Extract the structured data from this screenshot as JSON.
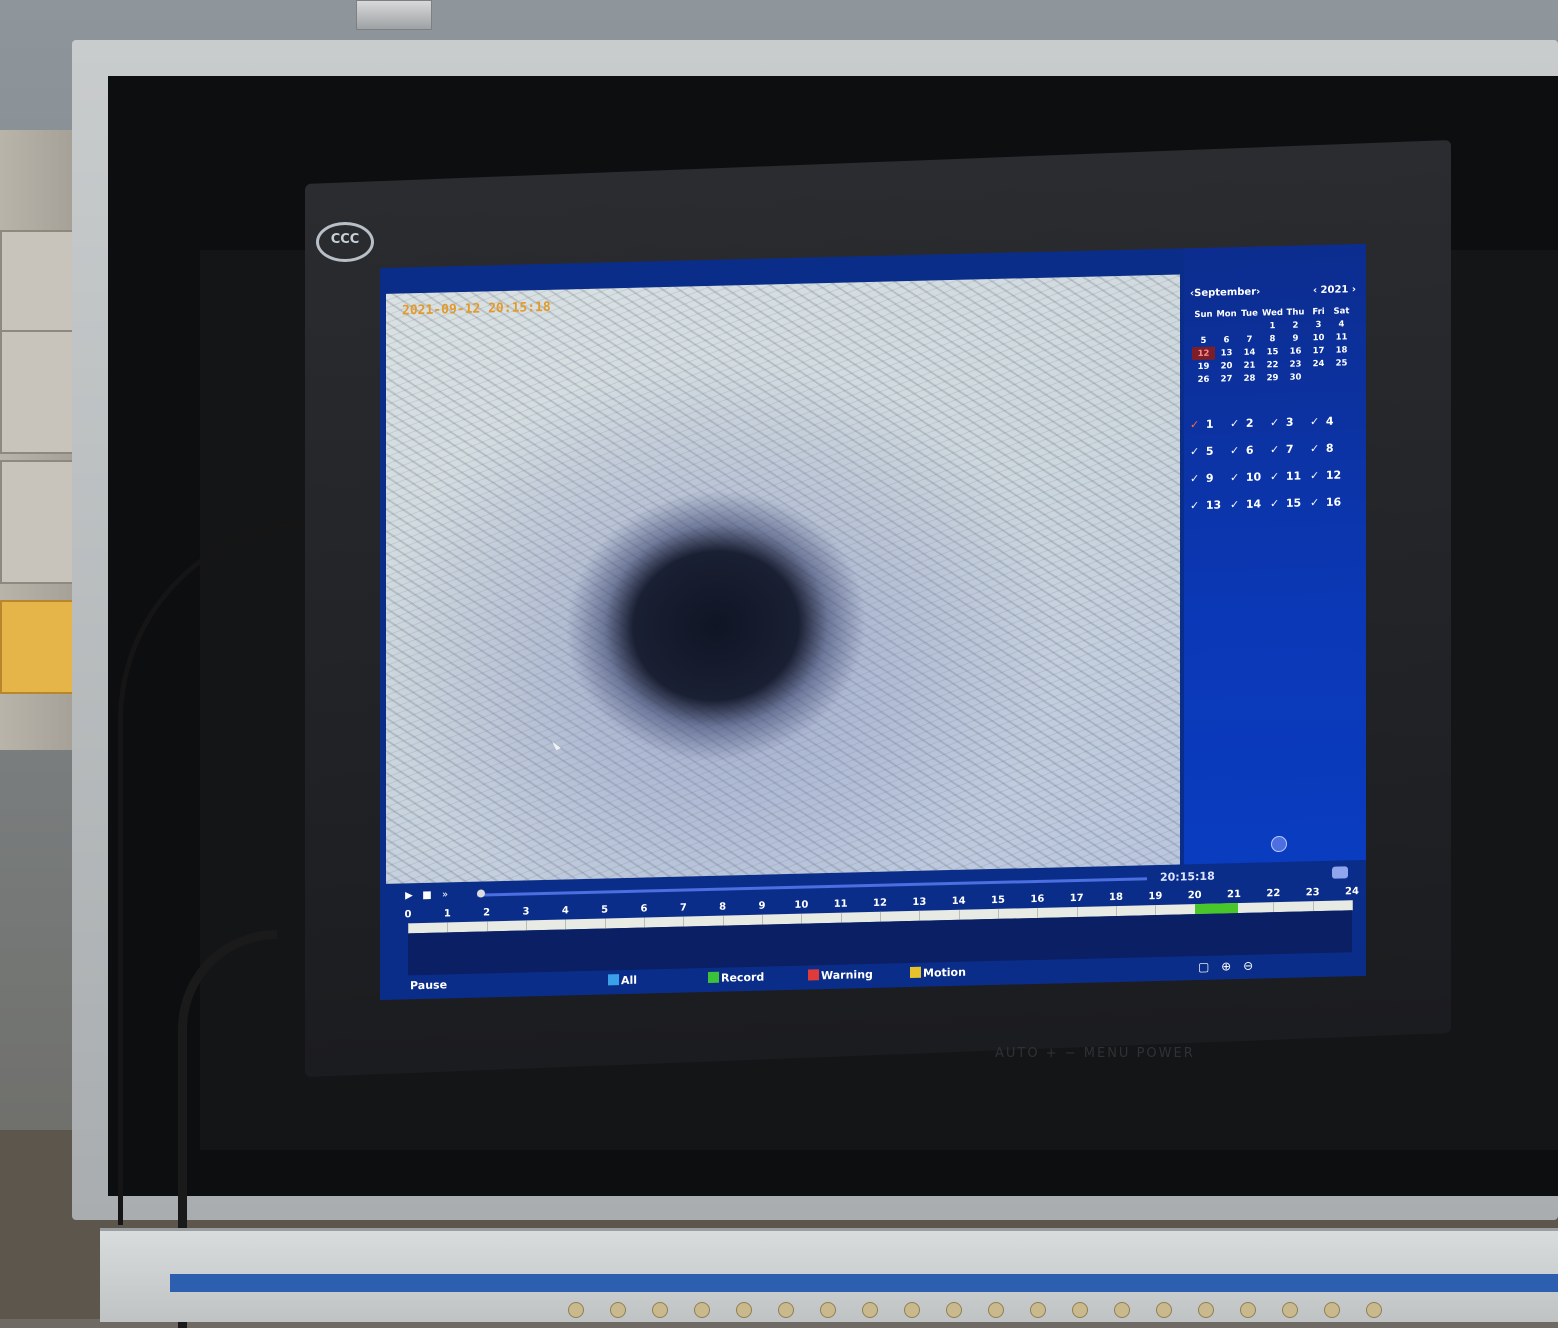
{
  "monitor": {
    "badge": "CCC",
    "hardware_buttons": "AUTO  +  −  MENU POWER"
  },
  "video": {
    "osd_text": "2021-09-12  20:15:18"
  },
  "calendar": {
    "month": "September",
    "year": "2021",
    "weekdays": [
      "Sun",
      "Mon",
      "Tue",
      "Wed",
      "Thu",
      "Fri",
      "Sat"
    ],
    "weeks": [
      [
        "",
        "",
        "",
        "1",
        "2",
        "3",
        "4"
      ],
      [
        "5",
        "6",
        "7",
        "8",
        "9",
        "10",
        "11"
      ],
      [
        "12",
        "13",
        "14",
        "15",
        "16",
        "17",
        "18"
      ],
      [
        "19",
        "20",
        "21",
        "22",
        "23",
        "24",
        "25"
      ],
      [
        "26",
        "27",
        "28",
        "29",
        "30",
        "",
        ""
      ]
    ],
    "selected_day": "12"
  },
  "channels": [
    "1",
    "2",
    "3",
    "4",
    "5",
    "6",
    "7",
    "8",
    "9",
    "10",
    "11",
    "12",
    "13",
    "14",
    "15",
    "16"
  ],
  "active_channel": "1",
  "playback": {
    "current_time": "20:15:18",
    "hours": [
      "0",
      "1",
      "2",
      "3",
      "4",
      "5",
      "6",
      "7",
      "8",
      "9",
      "10",
      "11",
      "12",
      "13",
      "14",
      "15",
      "16",
      "17",
      "18",
      "19",
      "20",
      "21",
      "22",
      "23",
      "24"
    ],
    "recorded_from_hour": 20.0,
    "recorded_to_hour": 21.1,
    "status": "Pause"
  },
  "legend": {
    "all": "All",
    "record": "Record",
    "warning": "Warning",
    "motion": "Motion",
    "colors": {
      "all": "#3aa0e8",
      "record": "#3cc23a",
      "warning": "#e03a3a",
      "motion": "#e8c22a"
    }
  },
  "icons": {
    "play": "play-icon",
    "stop": "stop-icon",
    "fast_forward": "fast-forward-icon",
    "fullscreen": "fullscreen-icon",
    "zoom_in": "zoom-in-icon",
    "zoom_out": "zoom-out-icon",
    "menu": "menu-icon"
  }
}
